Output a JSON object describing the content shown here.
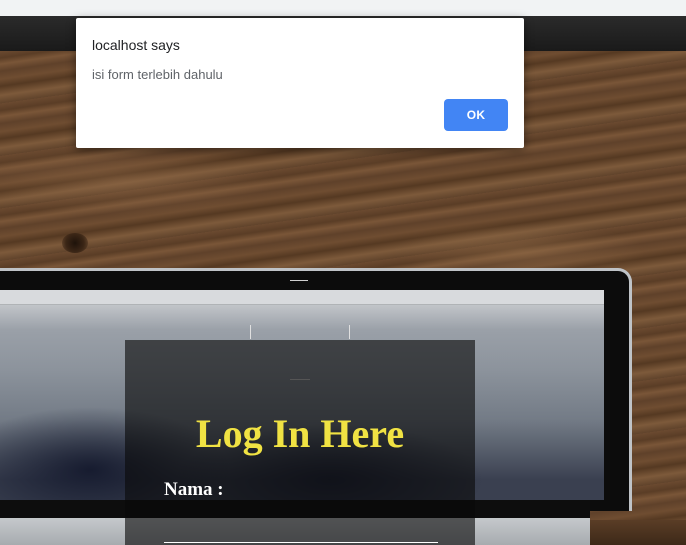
{
  "alert": {
    "title": "localhost says",
    "message": "isi form terlebih dahulu",
    "ok_label": "OK"
  },
  "login": {
    "heading": "Log In Here",
    "nama_label": "Nama :",
    "nama_value": ""
  },
  "colors": {
    "heading": "#f0e243",
    "ok_button": "#4285f4"
  }
}
